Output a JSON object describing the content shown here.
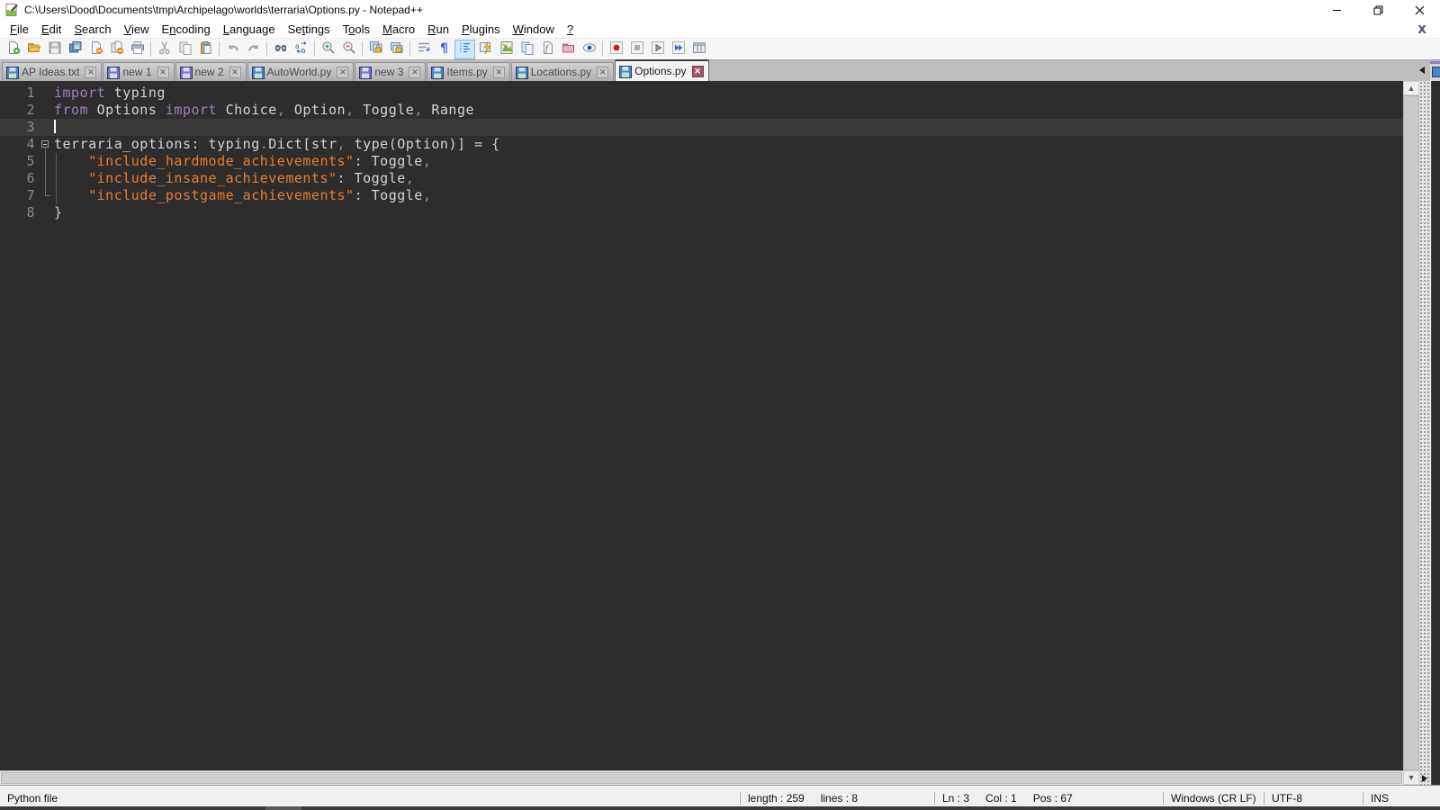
{
  "window": {
    "title": "C:\\Users\\Dood\\Documents\\tmp\\Archipelago\\worlds\\terraria\\Options.py - Notepad++",
    "controls": {
      "minimize": "minimize",
      "restore": "restore",
      "close": "close"
    },
    "doc_close_label": "X"
  },
  "menu": {
    "items": [
      {
        "label": "File",
        "accel": 0
      },
      {
        "label": "Edit",
        "accel": 0
      },
      {
        "label": "Search",
        "accel": 0
      },
      {
        "label": "View",
        "accel": 0
      },
      {
        "label": "Encoding",
        "accel": 1
      },
      {
        "label": "Language",
        "accel": 0
      },
      {
        "label": "Settings",
        "accel": 2
      },
      {
        "label": "Tools",
        "accel": 1
      },
      {
        "label": "Macro",
        "accel": 0
      },
      {
        "label": "Run",
        "accel": 0
      },
      {
        "label": "Plugins",
        "accel": 0
      },
      {
        "label": "Window",
        "accel": 0
      },
      {
        "label": "?",
        "accel": 0
      }
    ]
  },
  "toolbar": {
    "buttons": [
      {
        "name": "new-file"
      },
      {
        "name": "open-file"
      },
      {
        "name": "save",
        "disabled": true
      },
      {
        "name": "save-all"
      },
      {
        "name": "close",
        "disabled": false
      },
      {
        "name": "close-all",
        "disabled": false
      },
      {
        "name": "print"
      },
      "|",
      {
        "name": "cut",
        "disabled": true
      },
      {
        "name": "copy",
        "disabled": true
      },
      {
        "name": "paste"
      },
      "|",
      {
        "name": "undo",
        "disabled": true
      },
      {
        "name": "redo",
        "disabled": true
      },
      "|",
      {
        "name": "find"
      },
      {
        "name": "replace"
      },
      "|",
      {
        "name": "zoom-in"
      },
      {
        "name": "zoom-out"
      },
      "|",
      {
        "name": "sync-vertical-scroll"
      },
      {
        "name": "sync-horizontal-scroll"
      },
      "|",
      {
        "name": "word-wrap"
      },
      {
        "name": "show-all-characters"
      },
      {
        "name": "indent-guide",
        "active": true
      },
      {
        "name": "function-completion"
      },
      {
        "name": "document-map"
      },
      {
        "name": "document-list"
      },
      {
        "name": "function-list"
      },
      {
        "name": "folder-as-workspace"
      },
      {
        "name": "file-monitoring"
      },
      "|",
      {
        "name": "macro-record"
      },
      {
        "name": "macro-stop",
        "disabled": true
      },
      {
        "name": "macro-play"
      },
      {
        "name": "macro-run-multiple"
      },
      {
        "name": "macro-save"
      }
    ]
  },
  "tabs": [
    {
      "label": "AP Ideas.txt",
      "state": "saved",
      "active": false
    },
    {
      "label": "new 1",
      "state": "modified",
      "active": false
    },
    {
      "label": "new 2",
      "state": "modified",
      "active": false
    },
    {
      "label": "AutoWorld.py",
      "state": "saved",
      "active": false
    },
    {
      "label": "new 3",
      "state": "modified",
      "active": false
    },
    {
      "label": "Items.py",
      "state": "saved",
      "active": false
    },
    {
      "label": "Locations.py",
      "state": "saved",
      "active": false
    },
    {
      "label": "Options.py",
      "state": "saved",
      "active": true
    }
  ],
  "editor": {
    "language": "Python",
    "current_line": 3,
    "caret": {
      "line": 3,
      "col": 1
    },
    "folds": {
      "4": "box",
      "5": "line",
      "6": "line",
      "7": "end"
    },
    "lines": [
      [
        [
          "kw",
          "import"
        ],
        [
          "pl",
          " typing"
        ]
      ],
      [
        [
          "kw",
          "from"
        ],
        [
          "pl",
          " Options "
        ],
        [
          "kw",
          "import"
        ],
        [
          "pl",
          " Choice"
        ],
        [
          "pu",
          ","
        ],
        [
          "pl",
          " Option"
        ],
        [
          "pu",
          ","
        ],
        [
          "pl",
          " Toggle"
        ],
        [
          "pu",
          ","
        ],
        [
          "pl",
          " Range"
        ]
      ],
      [],
      [
        [
          "pl",
          "terraria_options"
        ],
        [
          "op",
          ":"
        ],
        [
          "pl",
          " typing"
        ],
        [
          "pu",
          "."
        ],
        [
          "pl",
          "Dict"
        ],
        [
          "op",
          "["
        ],
        [
          "pl",
          "str"
        ],
        [
          "pu",
          ","
        ],
        [
          "pl",
          " type"
        ],
        [
          "op",
          "("
        ],
        [
          "pl",
          "Option"
        ],
        [
          "op",
          ")"
        ],
        [
          "op",
          "]"
        ],
        [
          "pl",
          " "
        ],
        [
          "op",
          "="
        ],
        [
          "pl",
          " "
        ],
        [
          "op",
          "{"
        ]
      ],
      [
        [
          "pl",
          "    "
        ],
        [
          "st",
          "\"include_hardmode_achievements\""
        ],
        [
          "op",
          ":"
        ],
        [
          "pl",
          " Toggle"
        ],
        [
          "pu",
          ","
        ]
      ],
      [
        [
          "pl",
          "    "
        ],
        [
          "st",
          "\"include_insane_achievements\""
        ],
        [
          "op",
          ":"
        ],
        [
          "pl",
          " Toggle"
        ],
        [
          "pu",
          ","
        ]
      ],
      [
        [
          "pl",
          "    "
        ],
        [
          "st",
          "\"include_postgame_achievements\""
        ],
        [
          "op",
          ":"
        ],
        [
          "pl",
          " Toggle"
        ],
        [
          "pu",
          ","
        ]
      ],
      [
        [
          "op",
          "}"
        ]
      ]
    ]
  },
  "statusbar": {
    "doc_type": "Python file",
    "length": "length : 259",
    "lines": "lines : 8",
    "line": "Ln : 3",
    "column": "Col : 1",
    "position": "Pos : 67",
    "eol": "Windows (CR LF)",
    "encoding": "UTF-8",
    "insert_mode": "INS"
  },
  "colors": {
    "editor_background": "#2d2d2d",
    "current_line_background": "#3a3a3a",
    "keyword": "#a77dbd",
    "string": "#ec7d2c",
    "identifier": "#d4d4d4",
    "punctuation": "#8f8f8f",
    "line_number": "#8a8a8a",
    "saved_file_icon": "#4f81c8",
    "modified_file_icon": "#7a6fc0",
    "active_tab_close": "#a8566a",
    "selected_tool_background": "#cfe8fb"
  }
}
